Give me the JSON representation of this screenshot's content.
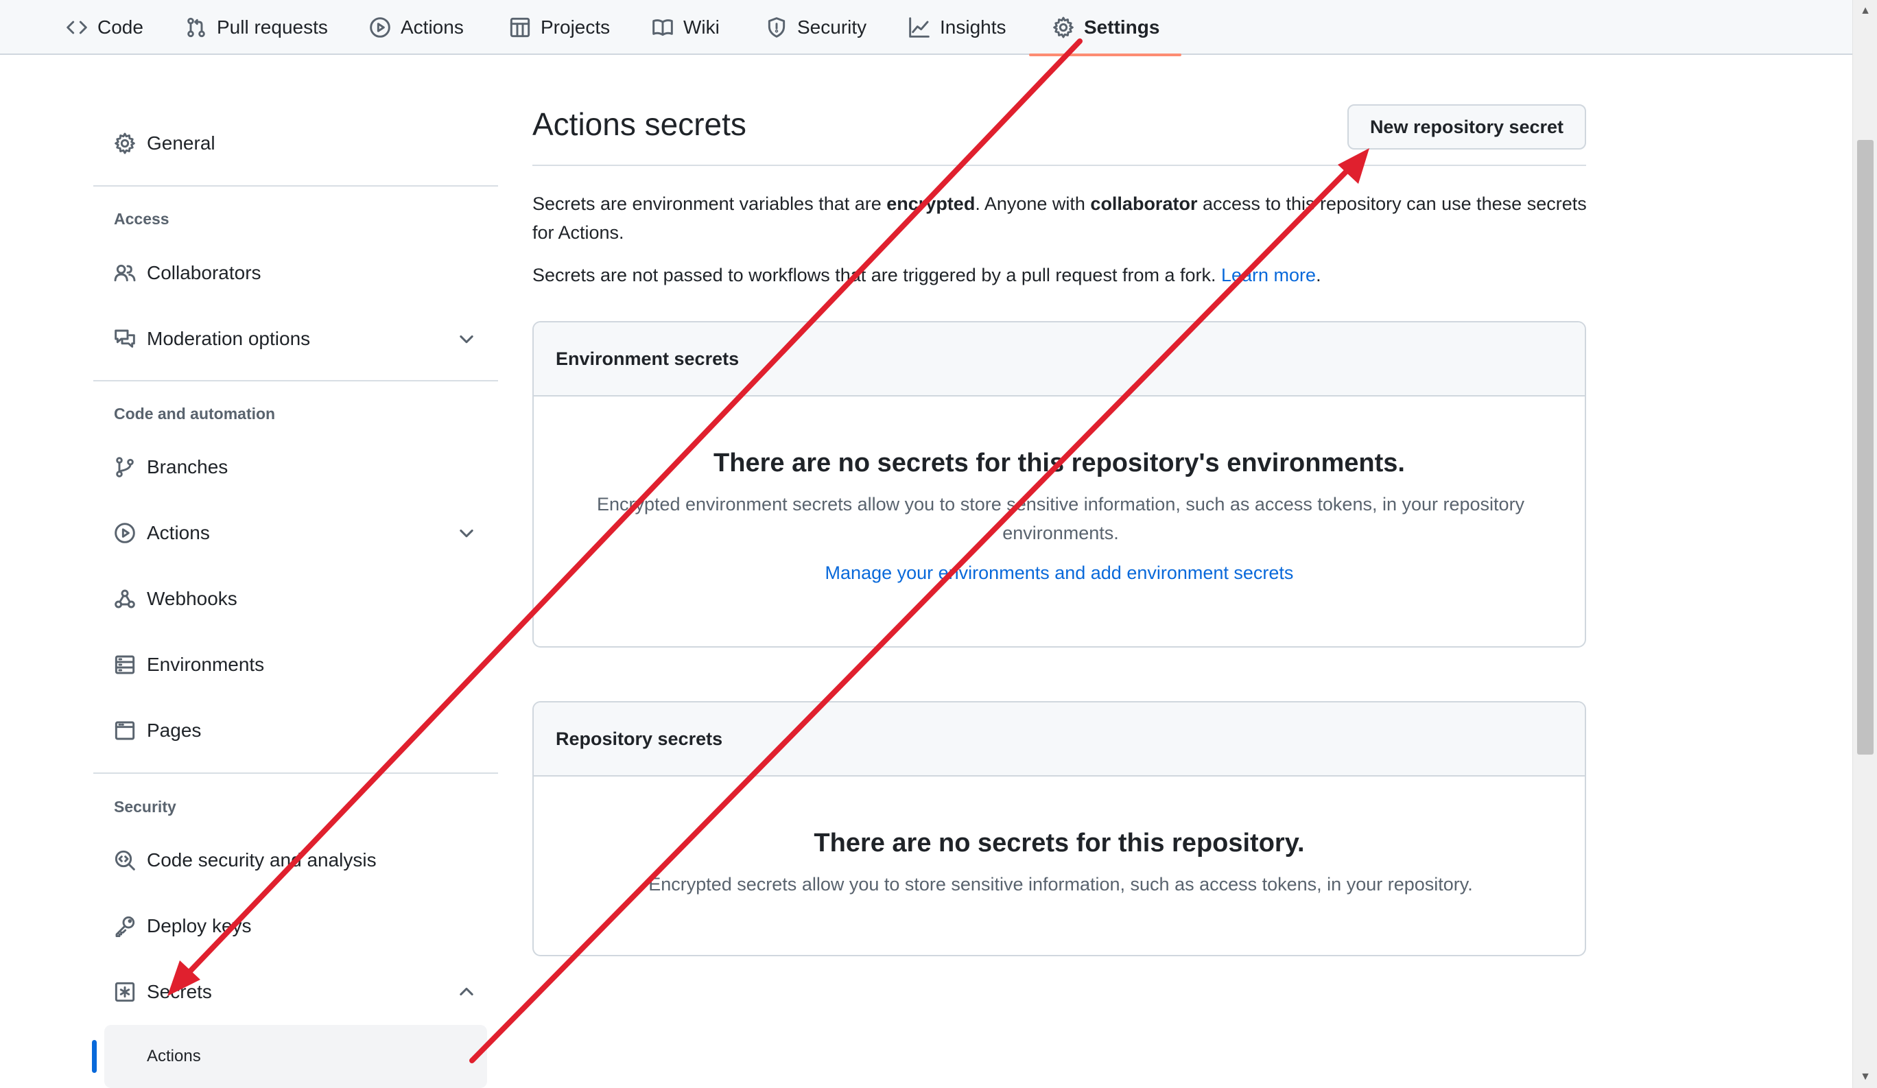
{
  "repo_nav": {
    "tabs": [
      {
        "label": "Code",
        "icon": "code-icon"
      },
      {
        "label": "Pull requests",
        "icon": "git-pull-request-icon"
      },
      {
        "label": "Actions",
        "icon": "play-circle-icon"
      },
      {
        "label": "Projects",
        "icon": "table-icon"
      },
      {
        "label": "Wiki",
        "icon": "book-icon"
      },
      {
        "label": "Security",
        "icon": "shield-icon"
      },
      {
        "label": "Insights",
        "icon": "graph-icon"
      },
      {
        "label": "Settings",
        "icon": "gear-icon",
        "selected": true
      }
    ]
  },
  "sidebar": {
    "general": "General",
    "access_heading": "Access",
    "collaborators": "Collaborators",
    "moderation": "Moderation options",
    "code_heading": "Code and automation",
    "branches": "Branches",
    "actions": "Actions",
    "webhooks": "Webhooks",
    "environments": "Environments",
    "pages": "Pages",
    "security_heading": "Security",
    "code_security": "Code security and analysis",
    "deploy_keys": "Deploy keys",
    "secrets": "Secrets",
    "secrets_actions": "Actions"
  },
  "main": {
    "title": "Actions secrets",
    "new_button": "New repository secret",
    "intro": {
      "p1_a": "Secrets are environment variables that are ",
      "p1_b": "encrypted",
      "p1_c": ". Anyone with ",
      "p1_d": "collaborator",
      "p1_e": " access to this repository can use these secrets for Actions.",
      "p2_a": "Secrets are not passed to workflows that are triggered by a pull request from a fork. ",
      "p2_link": "Learn more",
      "p2_end": "."
    },
    "env_box": {
      "header": "Environment secrets",
      "blank_title": "There are no secrets for this repository's environments.",
      "blank_text": "Encrypted environment secrets allow you to store sensitive information, such as access tokens, in your repository environments.",
      "link": "Manage your environments and add environment secrets"
    },
    "repo_box": {
      "header": "Repository secrets",
      "blank_title": "There are no secrets for this repository.",
      "blank_text": "Encrypted secrets allow you to store sensitive information, such as access tokens, in your repository."
    }
  },
  "colors": {
    "annotation_arrow": "#e0202e",
    "link": "#0969da",
    "selected_tab_underline": "#fd8c73",
    "active_marker": "#0969da"
  }
}
